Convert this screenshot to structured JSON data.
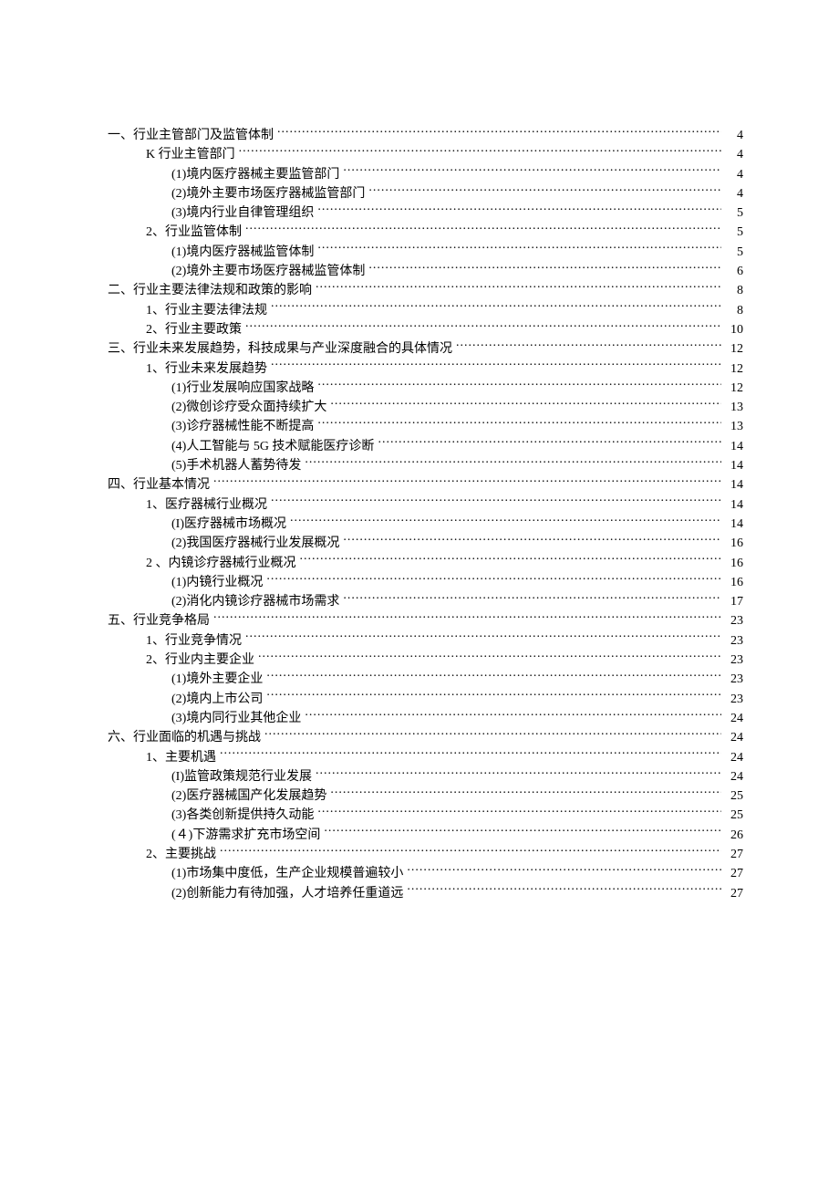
{
  "toc": [
    {
      "level": 0,
      "title": "一、行业主管部门及监管体制",
      "page": "4"
    },
    {
      "level": 1,
      "title": "K 行业主管部门",
      "page": "4"
    },
    {
      "level": 2,
      "title": "(1)境内医疗器械主要监管部门",
      "page": "4"
    },
    {
      "level": 2,
      "title": "(2)境外主要市场医疗器械监管部门",
      "page": "4"
    },
    {
      "level": 2,
      "title": "(3)境内行业自律管理组织",
      "page": "5"
    },
    {
      "level": 1,
      "title": "2、行业监管体制",
      "page": "5"
    },
    {
      "level": 2,
      "title": "(1)境内医疗器械监管体制",
      "page": "5"
    },
    {
      "level": 2,
      "title": "(2)境外主要市场医疗器械监管体制",
      "page": "6"
    },
    {
      "level": 0,
      "title": "二、行业主要法律法规和政策的影响",
      "page": "8"
    },
    {
      "level": 1,
      "title": "1、行业主要法律法规",
      "page": "8"
    },
    {
      "level": 1,
      "title": "2、行业主要政策",
      "page": "10"
    },
    {
      "level": 0,
      "title": "三、行业未来发展趋势，科技成果与产业深度融合的具体情况",
      "page": "12"
    },
    {
      "level": 1,
      "title": "1、行业未来发展趋势",
      "page": "12"
    },
    {
      "level": 2,
      "title": "(1)行业发展响应国家战略",
      "page": "12"
    },
    {
      "level": 2,
      "title": "(2)微创诊疗受众面持续扩大",
      "page": "13"
    },
    {
      "level": 2,
      "title": "(3)诊疗器械性能不断提高",
      "page": "13"
    },
    {
      "level": 2,
      "title": "(4)人工智能与 5G 技术赋能医疗诊断",
      "page": "14"
    },
    {
      "level": 2,
      "title": "(5)手术机器人蓄势待发",
      "page": "14"
    },
    {
      "level": 0,
      "title": "四、行业基本情况",
      "page": "14"
    },
    {
      "level": 1,
      "title": "1、医疗器械行业概况",
      "page": "14"
    },
    {
      "level": 2,
      "title": "(I)医疗器械市场概况",
      "page": "14"
    },
    {
      "level": 2,
      "title": "(2)我国医疗器械行业发展概况",
      "page": "16"
    },
    {
      "level": 1,
      "title": "2 、内镜诊疗器械行业概况",
      "page": "16"
    },
    {
      "level": 2,
      "title": "(1)内镜行业概况",
      "page": "16"
    },
    {
      "level": 2,
      "title": "(2)消化内镜诊疗器械市场需求",
      "page": "17"
    },
    {
      "level": 0,
      "title": "五、行业竞争格局",
      "page": "23"
    },
    {
      "level": 1,
      "title": "1、行业竞争情况",
      "page": "23"
    },
    {
      "level": 1,
      "title": "2、行业内主要企业",
      "page": "23"
    },
    {
      "level": 2,
      "title": "(1)境外主要企业",
      "page": "23"
    },
    {
      "level": 2,
      "title": "(2)境内上市公司",
      "page": "23"
    },
    {
      "level": 2,
      "title": "(3)境内同行业其他企业",
      "page": "24"
    },
    {
      "level": 0,
      "title": "六、行业面临的机遇与挑战",
      "page": "24"
    },
    {
      "level": 1,
      "title": "1、主要机遇",
      "page": "24"
    },
    {
      "level": 2,
      "title": "(I)监管政策规范行业发展",
      "page": "24"
    },
    {
      "level": 2,
      "title": "(2)医疗器械国产化发展趋势",
      "page": "25"
    },
    {
      "level": 2,
      "title": "(3)各类创新提供持久动能",
      "page": "25"
    },
    {
      "level": 2,
      "title": "(４)下游需求扩充市场空间",
      "page": "26"
    },
    {
      "level": 1,
      "title": "2、主要挑战",
      "page": "27"
    },
    {
      "level": 2,
      "title": "(1)市场集中度低，生产企业规模普遍较小",
      "page": "27"
    },
    {
      "level": 2,
      "title": "(2)创新能力有待加强，人才培养任重道远",
      "page": "27"
    }
  ]
}
